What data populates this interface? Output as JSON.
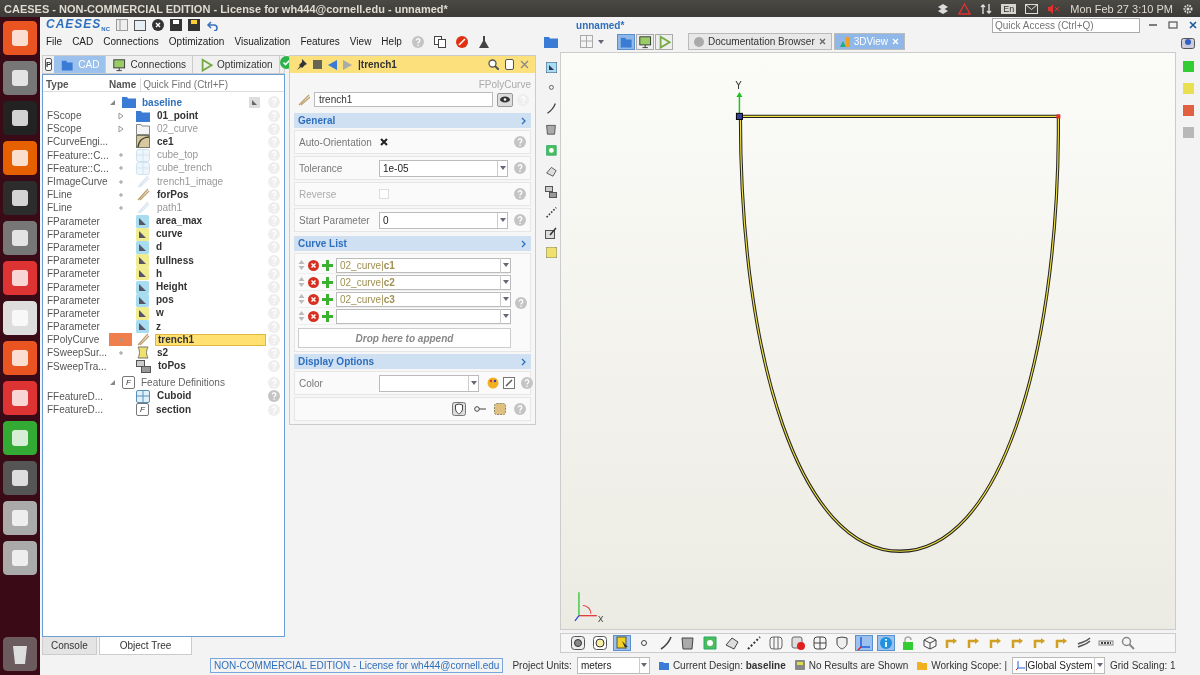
{
  "os_bar": {
    "title": "CAESES - NON-COMMERCIAL EDITION - License for wh444@cornell.edu - unnamed*",
    "keyboard": "En",
    "clock": "Mon Feb 27  3:10 PM"
  },
  "app": {
    "logo": "CAESES",
    "logo_suffix": "NC",
    "document_title": "unnamed*",
    "quick_access": {
      "placeholder": "Quick Access (Ctrl+Q)"
    }
  },
  "menu": [
    "File",
    "CAD",
    "Connections",
    "Optimization",
    "Visualization",
    "Features",
    "View",
    "Help"
  ],
  "left_panel": {
    "pin_button": "P",
    "tabs": [
      {
        "label": "CAD",
        "selected": true
      },
      {
        "label": "Connections",
        "selected": false
      },
      {
        "label": "Optimization",
        "selected": false
      }
    ]
  },
  "tree": {
    "columns": [
      "Type",
      "Name"
    ],
    "quick_find": {
      "placeholder": "Quick Find (Ctrl+F)"
    },
    "groups": [
      {
        "name": "baseline",
        "kind": "folder",
        "expanded": true,
        "children": [
          {
            "type": "FScope",
            "name": "01_point",
            "kind": "folder",
            "expandable": true,
            "dimmed": false,
            "selected": false
          },
          {
            "type": "FScope",
            "name": "02_curve",
            "kind": "scope",
            "expandable": true,
            "dimmed": true,
            "selected": false
          },
          {
            "type": "FCurveEngi...",
            "name": "ce1",
            "kind": "engine",
            "expandable": false,
            "dimmed": false,
            "selected": false
          },
          {
            "type": "FFeature::C...",
            "name": "cube_top",
            "kind": "cube",
            "expandable": true,
            "dimmed": true,
            "selected": false
          },
          {
            "type": "FFeature::C...",
            "name": "cube_trench",
            "kind": "cube",
            "expandable": true,
            "dimmed": true,
            "selected": false
          },
          {
            "type": "FImageCurve",
            "name": "trench1_image",
            "kind": "curve",
            "expandable": true,
            "dimmed": true,
            "selected": false
          },
          {
            "type": "FLine",
            "name": "forPos",
            "kind": "curve",
            "expandable": true,
            "dimmed": false,
            "selected": false
          },
          {
            "type": "FLine",
            "name": "path1",
            "kind": "curve",
            "expandable": true,
            "dimmed": true,
            "selected": false
          },
          {
            "type": "FParameter",
            "name": "area_max",
            "kind": "parameter",
            "color": "#a8dcf0",
            "expandable": false,
            "dimmed": false,
            "selected": false
          },
          {
            "type": "FParameter",
            "name": "curve",
            "kind": "parameter",
            "color": "#f0ec90",
            "expandable": false,
            "dimmed": false,
            "selected": false
          },
          {
            "type": "FParameter",
            "name": "d",
            "kind": "parameter",
            "color": "#a8dcf0",
            "expandable": false,
            "dimmed": false,
            "selected": false
          },
          {
            "type": "FParameter",
            "name": "fullness",
            "kind": "parameter",
            "color": "#f0ec90",
            "expandable": false,
            "dimmed": false,
            "selected": false
          },
          {
            "type": "FParameter",
            "name": "h",
            "kind": "parameter",
            "color": "#f0ec90",
            "expandable": false,
            "dimmed": false,
            "selected": false
          },
          {
            "type": "FParameter",
            "name": "Height",
            "kind": "parameter",
            "color": "#a8dcf0",
            "expandable": false,
            "dimmed": false,
            "selected": false
          },
          {
            "type": "FParameter",
            "name": "pos",
            "kind": "parameter",
            "color": "#a8dcf0",
            "expandable": false,
            "dimmed": false,
            "selected": false
          },
          {
            "type": "FParameter",
            "name": "w",
            "kind": "parameter",
            "color": "#f0ec90",
            "expandable": false,
            "dimmed": false,
            "selected": false
          },
          {
            "type": "FParameter",
            "name": "z",
            "kind": "parameter",
            "color": "#a8dcf0",
            "expandable": false,
            "dimmed": false,
            "selected": false
          },
          {
            "type": "FPolyCurve",
            "name": "trench1",
            "kind": "curve",
            "expandable": true,
            "dimmed": false,
            "selected": true
          },
          {
            "type": "FSweepSur...",
            "name": "s2",
            "kind": "surface",
            "expandable": true,
            "dimmed": false,
            "selected": false
          },
          {
            "type": "FSweepTra...",
            "name": "toPos",
            "kind": "transform",
            "expandable": false,
            "dimmed": false,
            "selected": false
          }
        ]
      },
      {
        "name": "Feature Definitions",
        "kind": "feature",
        "icon_text": "F",
        "expanded": true,
        "children": [
          {
            "type": "FFeatureD...",
            "name": "Cuboid",
            "kind": "cuboid",
            "expandable": false,
            "dimmed": false,
            "selected": false
          },
          {
            "type": "FFeatureD...",
            "name": "section",
            "kind": "feature",
            "icon_text": "F",
            "expandable": false,
            "dimmed": false,
            "selected": false
          }
        ]
      }
    ]
  },
  "bottom_tabs": [
    {
      "label": "Console",
      "selected": false
    },
    {
      "label": "Object Tree",
      "selected": true
    }
  ],
  "properties": {
    "title": "|trench1",
    "type_label": "FPolyCurve",
    "name_field": {
      "value": "trench1"
    },
    "sections": [
      {
        "title": "General",
        "kind": "fields",
        "rows": [
          {
            "kind": "checkbox",
            "label": "Auto-Orientation",
            "checked": true,
            "disabled": false
          },
          {
            "kind": "combo",
            "label": "Tolerance",
            "value": "1e-05"
          },
          {
            "kind": "checkbox",
            "label": "Reverse",
            "checked": false,
            "disabled": true
          },
          {
            "kind": "combo",
            "label": "Start Parameter",
            "value": "0"
          }
        ]
      },
      {
        "title": "Curve List",
        "kind": "list",
        "items": [
          "02_curve|**c1**",
          "02_curve|**c2**",
          "02_curve|**c3**"
        ],
        "trailing_empty_row": true,
        "drop_hint": "Drop here to append"
      },
      {
        "title": "Display Options",
        "kind": "fields",
        "rows": [
          {
            "kind": "color",
            "label": "Color"
          },
          {
            "kind": "tools"
          }
        ]
      }
    ]
  },
  "view": {
    "tabs": [
      {
        "label": "Documentation Browser",
        "selected": false
      },
      {
        "label": "3DView",
        "selected": true
      }
    ],
    "mode_buttons": [
      {
        "kind": "cad",
        "selected": true
      },
      {
        "kind": "connections",
        "selected": false
      },
      {
        "kind": "optimization",
        "selected": false
      }
    ],
    "axis_labels": {
      "origin": "Y",
      "triad": "x"
    },
    "toolbar": [
      {
        "kind": "target",
        "active": false
      },
      {
        "kind": "ring",
        "active": false
      },
      {
        "kind": "select",
        "active": true
      },
      {
        "kind": "dot",
        "active": false
      },
      {
        "kind": "curve",
        "active": false
      },
      {
        "kind": "surface",
        "active": false
      },
      {
        "kind": "surface-green",
        "active": false
      },
      {
        "kind": "solid",
        "active": false
      },
      {
        "kind": "dots",
        "active": false
      },
      {
        "kind": "columns",
        "active": false
      },
      {
        "kind": "stop",
        "active": false
      },
      {
        "kind": "grid",
        "active": false
      },
      {
        "kind": "shield",
        "active": false
      },
      {
        "kind": "axes",
        "active": true
      },
      {
        "kind": "info",
        "active": true
      },
      {
        "kind": "lock",
        "active": false
      },
      {
        "kind": "cube",
        "active": false
      },
      {
        "kind": "rotate",
        "active": false
      },
      {
        "kind": "rotate",
        "active": false
      },
      {
        "kind": "rotate",
        "active": false
      },
      {
        "kind": "rotate",
        "active": false
      },
      {
        "kind": "rotate",
        "active": false
      },
      {
        "kind": "rotate",
        "active": false
      },
      {
        "kind": "sweep",
        "active": false
      },
      {
        "kind": "more",
        "active": false
      },
      {
        "kind": "zoom",
        "active": false
      }
    ],
    "palette": [
      {
        "color": "#33cc33"
      },
      {
        "color": "#e8e050"
      },
      {
        "color": "#e06040"
      },
      {
        "color": "#b8b8b8"
      }
    ]
  },
  "status_bar": {
    "license": "NON-COMMERCIAL EDITION - License for wh444@cornell.edu",
    "units_label": "Project Units:",
    "units": "meters",
    "design": "Current Design: **baseline**",
    "results": "No Results are Shown",
    "scope": "Working Scope: |",
    "system": "|Global System",
    "grid": "Grid Scaling: 1"
  }
}
